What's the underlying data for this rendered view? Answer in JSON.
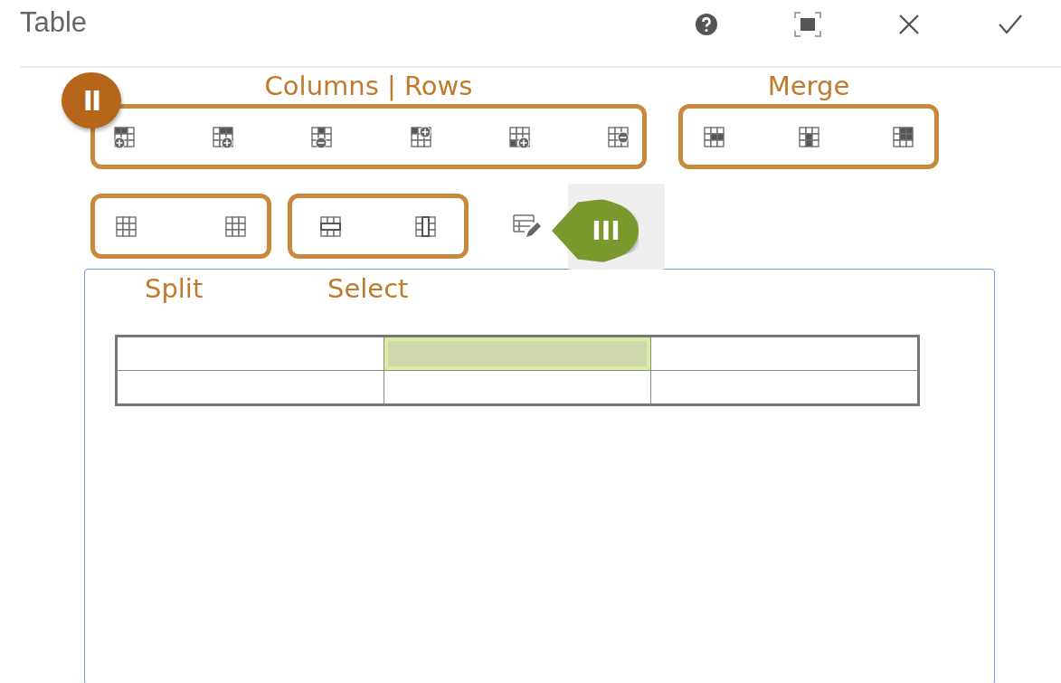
{
  "window": {
    "title": "Table"
  },
  "toolbar": {
    "rows": [
      {
        "groups": [
          {
            "label": "Columns | Rows",
            "label_below": false
          },
          {
            "label": "Merge",
            "label_below": false
          }
        ]
      },
      {
        "groups": [
          {
            "label": "Split",
            "label_below": true
          },
          {
            "label": "Select",
            "label_below": true
          }
        ]
      }
    ]
  },
  "callouts": [
    {
      "text": "II",
      "color": "#b5661a"
    },
    {
      "text": "III",
      "color": "#7b982c"
    }
  ],
  "table": {
    "rows": [
      {
        "cells": [
          {
            "selected": false
          },
          {
            "selected": true
          },
          {
            "selected": false
          }
        ]
      },
      {
        "cells": [
          {
            "selected": false
          },
          {
            "selected": false
          },
          {
            "selected": false
          }
        ]
      }
    ]
  }
}
